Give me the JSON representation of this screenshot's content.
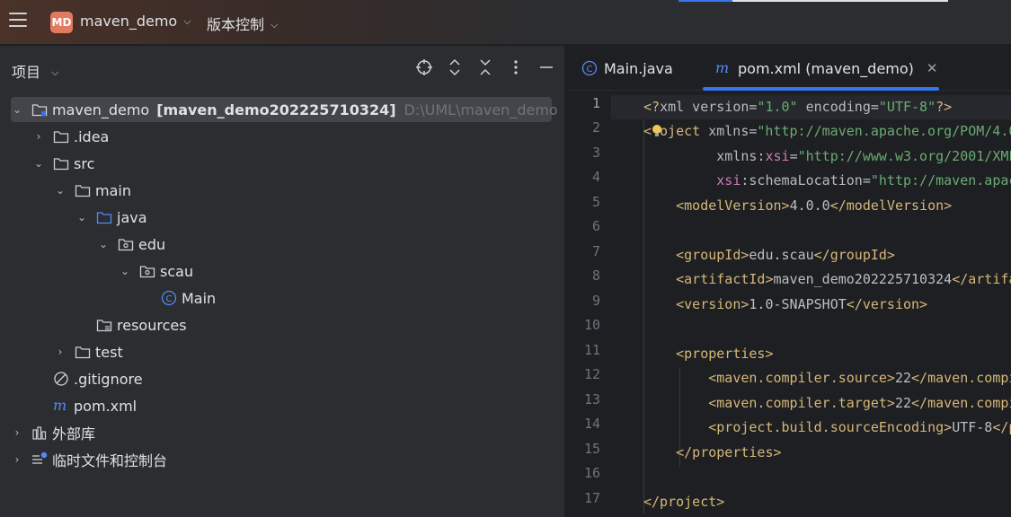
{
  "titlebar": {
    "project_badge": "MD",
    "project_name": "maven_demo",
    "vcs_label": "版本控制"
  },
  "project_panel": {
    "title": "项目",
    "tree": [
      {
        "label": "maven_demo",
        "bold": "[maven_demo202225710324]",
        "muted": "D:\\UML\\maven_demo"
      },
      {
        "label": ".idea"
      },
      {
        "label": "src"
      },
      {
        "label": "main"
      },
      {
        "label": "java"
      },
      {
        "label": "edu"
      },
      {
        "label": "scau"
      },
      {
        "label": "Main"
      },
      {
        "label": "resources"
      },
      {
        "label": "test"
      },
      {
        "label": ".gitignore"
      },
      {
        "label": "pom.xml"
      },
      {
        "label": "外部库"
      },
      {
        "label": "临时文件和控制台"
      }
    ]
  },
  "editor": {
    "tabs": [
      {
        "label": "Main.java",
        "active": false
      },
      {
        "label": "pom.xml (maven_demo)",
        "active": true
      }
    ],
    "line_numbers": [
      "1",
      "2",
      "3",
      "4",
      "5",
      "6",
      "7",
      "8",
      "9",
      "10",
      "11",
      "12",
      "13",
      "14",
      "15",
      "16",
      "17"
    ],
    "current_line": 1
  },
  "colors": {
    "accent": "#3574f0",
    "tag": "#d5b778",
    "string": "#6aab73",
    "namespace": "#c77dbb"
  }
}
